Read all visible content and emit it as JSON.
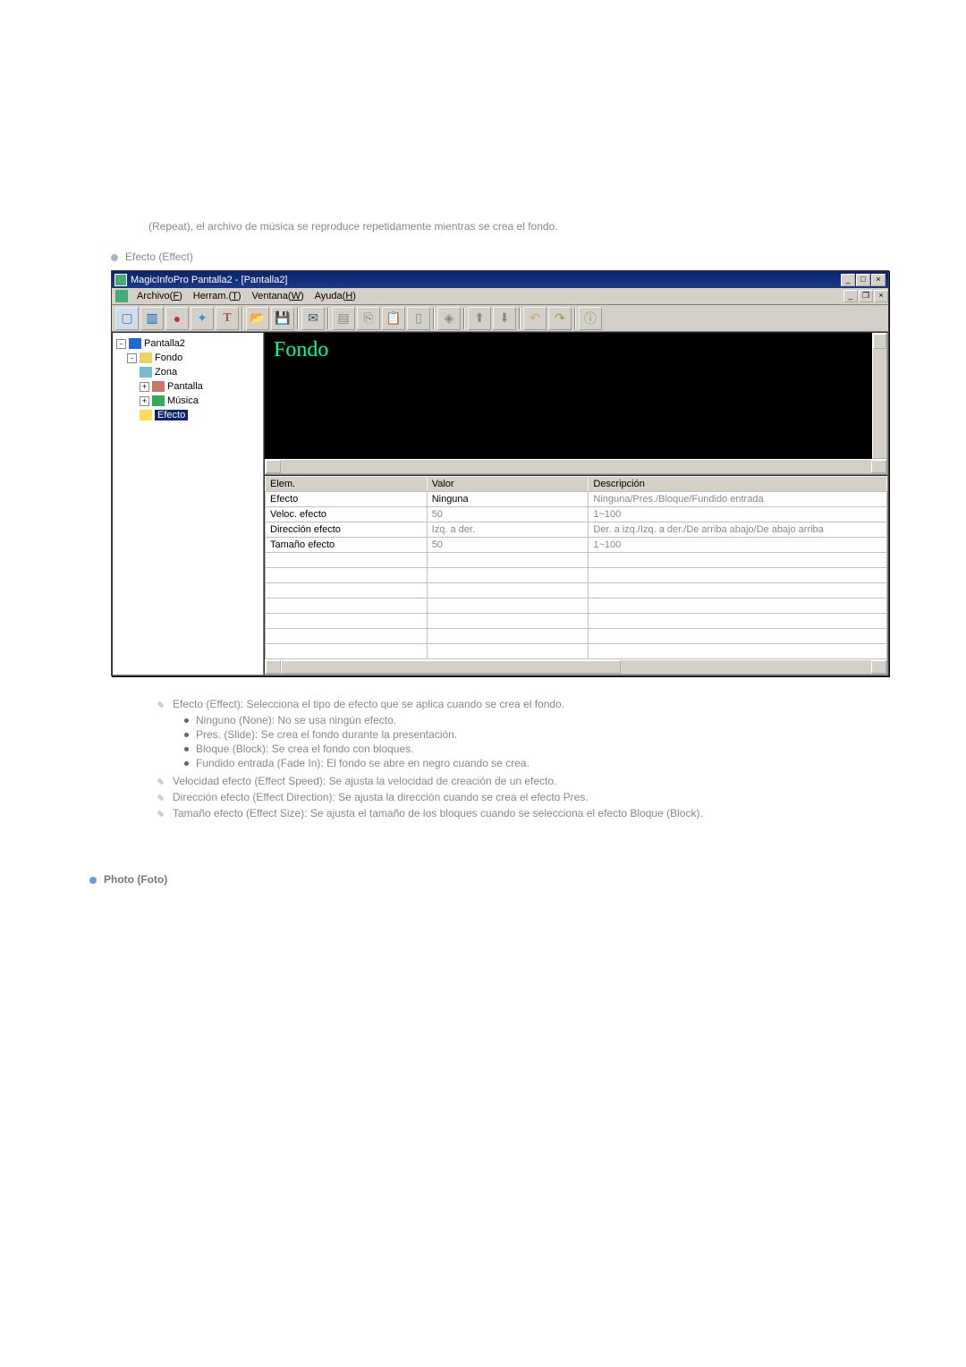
{
  "intro": "(Repeat), el archivo de música se reproduce repetidamente mientras se crea el fondo.",
  "sec_title": "Efecto (Effect)",
  "app": {
    "title": "MagicInfoPro Pantalla2 - [Pantalla2]",
    "menu": {
      "file": "Archivo(F)",
      "tools": "Herram.(T)",
      "window": "Ventana(W)",
      "help": "Ayuda(H)"
    },
    "tree": {
      "root": "Pantalla2",
      "fondo": "Fondo",
      "zona": "Zona",
      "pantalla": "Pantalla",
      "musica": "Música",
      "efecto": "Efecto"
    },
    "preview_label": "Fondo",
    "grid": {
      "h1": "Elem.",
      "h2": "Valor",
      "h3": "Descripción",
      "r": [
        {
          "e": "Efecto",
          "v": "Ninguna",
          "d": "Ninguna/Pres./Bloque/Fundido entrada",
          "dis": false
        },
        {
          "e": "Veloc. efecto",
          "v": "50",
          "d": "1~100",
          "dis": true
        },
        {
          "e": "Dirección efecto",
          "v": "Izq. a der.",
          "d": "Der. a izq./Izq. a der./De arriba abajo/De abajo arriba",
          "dis": true
        },
        {
          "e": "Tamaño efecto",
          "v": "50",
          "d": "1~100",
          "dis": true
        }
      ]
    }
  },
  "desc": {
    "i0": "Efecto (Effect): Selecciona el tipo de efecto que se aplica cuando se crea el fondo.",
    "b": [
      "Ninguno (None): No se usa ningún efecto.",
      "Pres. (Slide): Se crea el fondo durante la presentación.",
      "Bloque (Block): Se crea el fondo con bloques.",
      "Fundido entrada (Fade In): El fondo se abre en negro cuando se crea."
    ],
    "i1": "Velocidad efecto (Effect Speed): Se ajusta la velocidad de creación de un efecto.",
    "i2": "Dirección efecto (Effect Direction): Se ajusta la dirección cuando se crea el efecto Pres.",
    "i3": "Tamaño efecto (Effect Size): Se ajusta el tamaño de los bloques cuando se selecciona el efecto Bloque (Block)."
  },
  "foot": "Photo (Foto)"
}
